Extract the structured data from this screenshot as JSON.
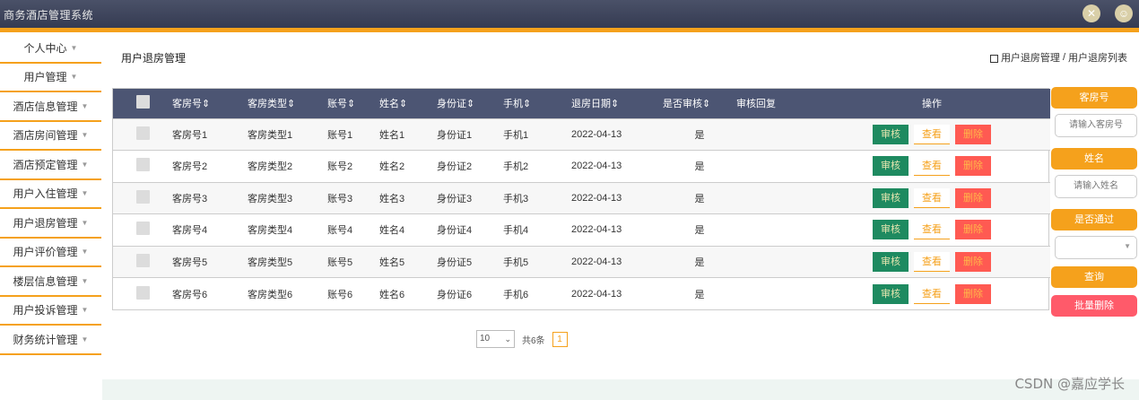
{
  "app": {
    "title": "商务酒店管理系统"
  },
  "sidebar": {
    "items": [
      {
        "label": "个人中心"
      },
      {
        "label": "用户管理"
      },
      {
        "label": "酒店信息管理"
      },
      {
        "label": "酒店房间管理"
      },
      {
        "label": "酒店预定管理"
      },
      {
        "label": "用户入住管理"
      },
      {
        "label": "用户退房管理"
      },
      {
        "label": "用户评价管理"
      },
      {
        "label": "楼层信息管理"
      },
      {
        "label": "用户投诉管理"
      },
      {
        "label": "财务统计管理"
      }
    ]
  },
  "header": {
    "page_title": "用户退房管理",
    "breadcrumb": [
      "用户退房管理",
      "/",
      "用户退房列表"
    ]
  },
  "table": {
    "columns": [
      "客房号",
      "客房类型",
      "账号",
      "姓名",
      "身份证",
      "手机",
      "退房日期",
      "是否审核",
      "审核回复",
      "操作"
    ],
    "rows": [
      {
        "room": "客房号1",
        "type": "客房类型1",
        "account": "账号1",
        "name": "姓名1",
        "id": "身份证1",
        "phone": "手机1",
        "date": "2022-04-13",
        "audit": "是",
        "reply": ""
      },
      {
        "room": "客房号2",
        "type": "客房类型2",
        "account": "账号2",
        "name": "姓名2",
        "id": "身份证2",
        "phone": "手机2",
        "date": "2022-04-13",
        "audit": "是",
        "reply": ""
      },
      {
        "room": "客房号3",
        "type": "客房类型3",
        "account": "账号3",
        "name": "姓名3",
        "id": "身份证3",
        "phone": "手机3",
        "date": "2022-04-13",
        "audit": "是",
        "reply": ""
      },
      {
        "room": "客房号4",
        "type": "客房类型4",
        "account": "账号4",
        "name": "姓名4",
        "id": "身份证4",
        "phone": "手机4",
        "date": "2022-04-13",
        "audit": "是",
        "reply": ""
      },
      {
        "room": "客房号5",
        "type": "客房类型5",
        "account": "账号5",
        "name": "姓名5",
        "id": "身份证5",
        "phone": "手机5",
        "date": "2022-04-13",
        "audit": "是",
        "reply": ""
      },
      {
        "room": "客房号6",
        "type": "客房类型6",
        "account": "账号6",
        "name": "姓名6",
        "id": "身份证6",
        "phone": "手机6",
        "date": "2022-04-13",
        "audit": "是",
        "reply": ""
      }
    ],
    "actions": {
      "audit": "审核",
      "view": "查看",
      "delete": "删除"
    }
  },
  "pager": {
    "page_size": "10",
    "total_text": "共6条",
    "current_page": "1"
  },
  "filters": {
    "room_label": "客房号",
    "room_placeholder": "请输入客房号",
    "name_label": "姓名",
    "name_placeholder": "请输入姓名",
    "approved_label": "是否通过",
    "approved_value": "",
    "search_label": "查询",
    "batch_delete_label": "批量删除"
  },
  "watermark": "CSDN @嘉应学长",
  "colors": {
    "accent": "#f5a11c",
    "header": "#4c5573",
    "audit": "#1e8a60",
    "delete": "#ff5a52"
  }
}
